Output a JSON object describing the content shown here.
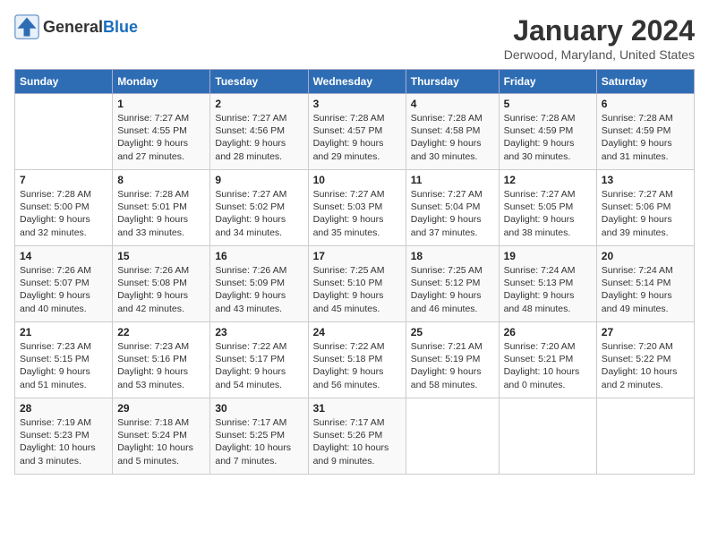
{
  "logo": {
    "text_general": "General",
    "text_blue": "Blue"
  },
  "title": "January 2024",
  "subtitle": "Derwood, Maryland, United States",
  "columns": [
    "Sunday",
    "Monday",
    "Tuesday",
    "Wednesday",
    "Thursday",
    "Friday",
    "Saturday"
  ],
  "weeks": [
    [
      {
        "day": "",
        "info": ""
      },
      {
        "day": "1",
        "info": "Sunrise: 7:27 AM\nSunset: 4:55 PM\nDaylight: 9 hours\nand 27 minutes."
      },
      {
        "day": "2",
        "info": "Sunrise: 7:27 AM\nSunset: 4:56 PM\nDaylight: 9 hours\nand 28 minutes."
      },
      {
        "day": "3",
        "info": "Sunrise: 7:28 AM\nSunset: 4:57 PM\nDaylight: 9 hours\nand 29 minutes."
      },
      {
        "day": "4",
        "info": "Sunrise: 7:28 AM\nSunset: 4:58 PM\nDaylight: 9 hours\nand 30 minutes."
      },
      {
        "day": "5",
        "info": "Sunrise: 7:28 AM\nSunset: 4:59 PM\nDaylight: 9 hours\nand 30 minutes."
      },
      {
        "day": "6",
        "info": "Sunrise: 7:28 AM\nSunset: 4:59 PM\nDaylight: 9 hours\nand 31 minutes."
      }
    ],
    [
      {
        "day": "7",
        "info": "Sunrise: 7:28 AM\nSunset: 5:00 PM\nDaylight: 9 hours\nand 32 minutes."
      },
      {
        "day": "8",
        "info": "Sunrise: 7:28 AM\nSunset: 5:01 PM\nDaylight: 9 hours\nand 33 minutes."
      },
      {
        "day": "9",
        "info": "Sunrise: 7:27 AM\nSunset: 5:02 PM\nDaylight: 9 hours\nand 34 minutes."
      },
      {
        "day": "10",
        "info": "Sunrise: 7:27 AM\nSunset: 5:03 PM\nDaylight: 9 hours\nand 35 minutes."
      },
      {
        "day": "11",
        "info": "Sunrise: 7:27 AM\nSunset: 5:04 PM\nDaylight: 9 hours\nand 37 minutes."
      },
      {
        "day": "12",
        "info": "Sunrise: 7:27 AM\nSunset: 5:05 PM\nDaylight: 9 hours\nand 38 minutes."
      },
      {
        "day": "13",
        "info": "Sunrise: 7:27 AM\nSunset: 5:06 PM\nDaylight: 9 hours\nand 39 minutes."
      }
    ],
    [
      {
        "day": "14",
        "info": "Sunrise: 7:26 AM\nSunset: 5:07 PM\nDaylight: 9 hours\nand 40 minutes."
      },
      {
        "day": "15",
        "info": "Sunrise: 7:26 AM\nSunset: 5:08 PM\nDaylight: 9 hours\nand 42 minutes."
      },
      {
        "day": "16",
        "info": "Sunrise: 7:26 AM\nSunset: 5:09 PM\nDaylight: 9 hours\nand 43 minutes."
      },
      {
        "day": "17",
        "info": "Sunrise: 7:25 AM\nSunset: 5:10 PM\nDaylight: 9 hours\nand 45 minutes."
      },
      {
        "day": "18",
        "info": "Sunrise: 7:25 AM\nSunset: 5:12 PM\nDaylight: 9 hours\nand 46 minutes."
      },
      {
        "day": "19",
        "info": "Sunrise: 7:24 AM\nSunset: 5:13 PM\nDaylight: 9 hours\nand 48 minutes."
      },
      {
        "day": "20",
        "info": "Sunrise: 7:24 AM\nSunset: 5:14 PM\nDaylight: 9 hours\nand 49 minutes."
      }
    ],
    [
      {
        "day": "21",
        "info": "Sunrise: 7:23 AM\nSunset: 5:15 PM\nDaylight: 9 hours\nand 51 minutes."
      },
      {
        "day": "22",
        "info": "Sunrise: 7:23 AM\nSunset: 5:16 PM\nDaylight: 9 hours\nand 53 minutes."
      },
      {
        "day": "23",
        "info": "Sunrise: 7:22 AM\nSunset: 5:17 PM\nDaylight: 9 hours\nand 54 minutes."
      },
      {
        "day": "24",
        "info": "Sunrise: 7:22 AM\nSunset: 5:18 PM\nDaylight: 9 hours\nand 56 minutes."
      },
      {
        "day": "25",
        "info": "Sunrise: 7:21 AM\nSunset: 5:19 PM\nDaylight: 9 hours\nand 58 minutes."
      },
      {
        "day": "26",
        "info": "Sunrise: 7:20 AM\nSunset: 5:21 PM\nDaylight: 10 hours\nand 0 minutes."
      },
      {
        "day": "27",
        "info": "Sunrise: 7:20 AM\nSunset: 5:22 PM\nDaylight: 10 hours\nand 2 minutes."
      }
    ],
    [
      {
        "day": "28",
        "info": "Sunrise: 7:19 AM\nSunset: 5:23 PM\nDaylight: 10 hours\nand 3 minutes."
      },
      {
        "day": "29",
        "info": "Sunrise: 7:18 AM\nSunset: 5:24 PM\nDaylight: 10 hours\nand 5 minutes."
      },
      {
        "day": "30",
        "info": "Sunrise: 7:17 AM\nSunset: 5:25 PM\nDaylight: 10 hours\nand 7 minutes."
      },
      {
        "day": "31",
        "info": "Sunrise: 7:17 AM\nSunset: 5:26 PM\nDaylight: 10 hours\nand 9 minutes."
      },
      {
        "day": "",
        "info": ""
      },
      {
        "day": "",
        "info": ""
      },
      {
        "day": "",
        "info": ""
      }
    ]
  ]
}
